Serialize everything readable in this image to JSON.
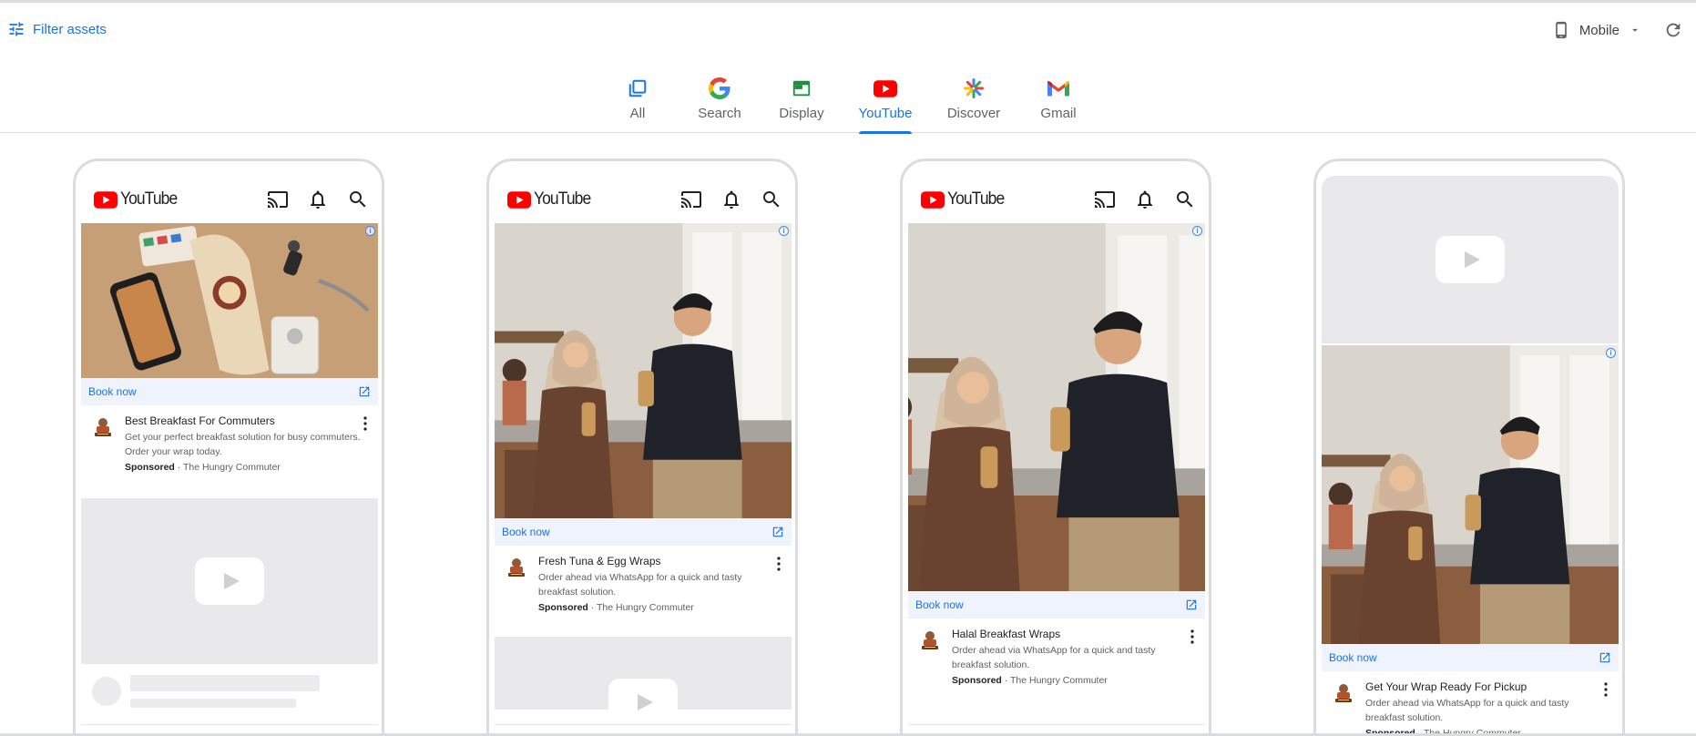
{
  "header": {
    "filter_label": "Filter assets",
    "device_label": "Mobile"
  },
  "tabs": [
    {
      "label": "All",
      "icon": "all-icon"
    },
    {
      "label": "Search",
      "icon": "google-icon"
    },
    {
      "label": "Display",
      "icon": "display-icon"
    },
    {
      "label": "YouTube",
      "icon": "youtube-icon",
      "active": true
    },
    {
      "label": "Discover",
      "icon": "discover-icon"
    },
    {
      "label": "Gmail",
      "icon": "gmail-icon"
    }
  ],
  "colors": {
    "accent": "#1a73e8",
    "youtube_red": "#ff0000",
    "placeholder": "#e9e9ec"
  },
  "previews": [
    {
      "app_name": "YouTube",
      "cta": "Book now",
      "headline": "Best Breakfast For Commuters",
      "description": "Get your perfect breakfast solution for busy commuters. Order your wrap today.",
      "sponsored": "Sponsored",
      "advertiser": "The Hungry Commuter",
      "image": "flatlay-phone-keys-wrap"
    },
    {
      "app_name": "YouTube",
      "cta": "Book now",
      "headline": "Fresh Tuna & Egg Wraps",
      "description": "Order ahead via WhatsApp for a quick and tasty breakfast solution.",
      "sponsored": "Sponsored",
      "advertiser": "The Hungry Commuter",
      "image": "coworkers-eating-wraps-square"
    },
    {
      "app_name": "YouTube",
      "cta": "Book now",
      "headline": "Halal Breakfast Wraps",
      "description": "Order ahead via WhatsApp for a quick and tasty breakfast solution.",
      "sponsored": "Sponsored",
      "advertiser": "The Hungry Commuter",
      "image": "coworkers-eating-wraps-portrait"
    },
    {
      "app_name": "",
      "cta": "Book now",
      "headline": "Get Your Wrap Ready For Pickup",
      "description": "Order ahead via WhatsApp for a quick and tasty breakfast solution.",
      "sponsored": "Sponsored",
      "advertiser": "The Hungry Commuter",
      "image": "coworkers-eating-wraps-portrait"
    }
  ]
}
